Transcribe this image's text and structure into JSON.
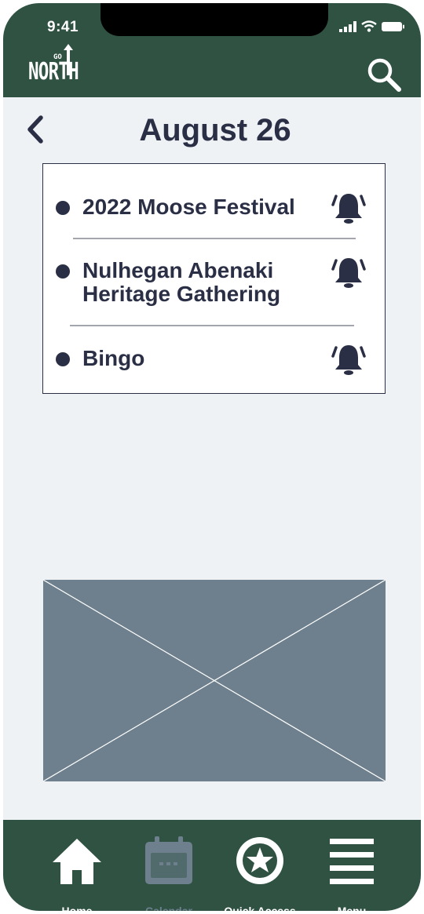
{
  "status_bar": {
    "time": "9:41"
  },
  "header": {
    "logo_main": "NORTH",
    "logo_small": "GO"
  },
  "page": {
    "title": "August 26"
  },
  "events": [
    {
      "name_lines": [
        "2022 Moose Festival"
      ]
    },
    {
      "name_lines": [
        "Nulhegan Abenaki",
        "Heritage Gathering"
      ]
    },
    {
      "name_lines": [
        "Bingo"
      ]
    }
  ],
  "tabs": {
    "home": "Home",
    "calendar": "Calendar",
    "quick_access": "Quick Access",
    "menu": "Menu"
  },
  "colors": {
    "header_bg": "#2f5243",
    "page_bg": "#eff2f5",
    "text_dark": "#2a2f45",
    "muted": "#6e808e"
  }
}
